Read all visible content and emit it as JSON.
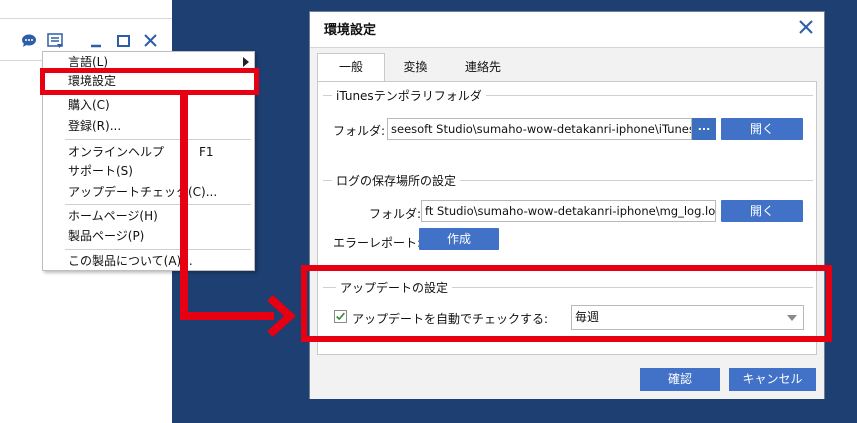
{
  "app": {
    "icons": [
      "chat-icon",
      "menu-icon",
      "minimize-icon",
      "maximize-icon",
      "close-icon"
    ]
  },
  "context_menu": {
    "items": [
      {
        "label": "言語(L)"
      },
      {
        "label": "環境設定"
      },
      {
        "label": "購入(C)"
      },
      {
        "label": "登録(R)..."
      },
      {
        "label": "オンラインヘルプ",
        "shortcut": "F1"
      },
      {
        "label": "サポート(S)"
      },
      {
        "label": "アップデートチェック(C)..."
      },
      {
        "label": "ホームページ(H)"
      },
      {
        "label": "製品ページ(P)"
      },
      {
        "label": "この製品について(A)..."
      }
    ]
  },
  "dialog": {
    "title": "環境設定",
    "tabs": [
      {
        "label": "一般",
        "active": true
      },
      {
        "label": "変換"
      },
      {
        "label": "連絡先"
      }
    ],
    "itunes_group": {
      "title": "iTunesテンポラリフォルダ",
      "folder_label": "フォルダ:",
      "folder_value": "seesoft Studio\\sumaho-wow-detakanri-iphone\\iTunes",
      "browse_label": "...",
      "open_label": "開く"
    },
    "log_group": {
      "title": "ログの保存場所の設定",
      "folder_label": "フォルダ:",
      "folder_value": "ft Studio\\sumaho-wow-detakanri-iphone\\mg_log.log",
      "open_label": "開く",
      "error_label": "エラーレポート:",
      "create_label": "作成"
    },
    "update_group": {
      "title": "アップデートの設定",
      "auto_check_label": "アップデートを自動でチェックする:",
      "auto_check_checked": true,
      "frequency_value": "毎週"
    },
    "ok_label": "確認",
    "cancel_label": "キャンセル"
  },
  "colors": {
    "highlight": "#e60012",
    "button_blue": "#4172c7",
    "background_navy": "#1d3f72"
  }
}
